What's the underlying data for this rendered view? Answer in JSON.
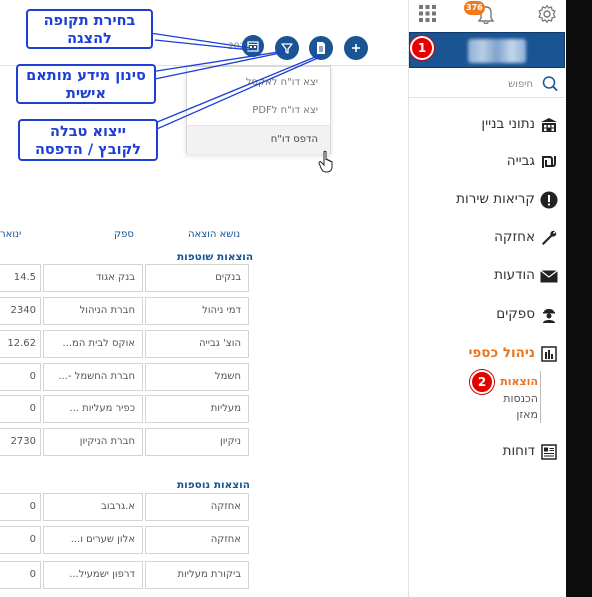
{
  "toolbar": {
    "year_value": "2021",
    "calendar_icon": "calendar-icon",
    "filter_icon": "filter-icon",
    "export_icon": "document-icon",
    "add_icon": "plus-icon"
  },
  "dropdown": {
    "items": [
      "יצא דו\"ח לאקסל",
      "יצא דו\"ח לPDF",
      "הדפס דו\"ח"
    ]
  },
  "callouts": {
    "period": [
      "בחירת תקופה",
      "להצגה"
    ],
    "filter": [
      "סינון מידע מותאם",
      "אישית"
    ],
    "export": [
      "ייצוא טבלה",
      "לקובץ / הדפסה"
    ]
  },
  "table": {
    "headers": [
      "נושא הוצאה",
      "ספק",
      "ינואר"
    ],
    "groups": [
      {
        "title": "הוצאות שוטפות",
        "rows": [
          {
            "subject": "בנקים",
            "supplier": "בנק אגוד",
            "value": "14.5"
          },
          {
            "subject": "דמי ניהול",
            "supplier": "חברת הניהול",
            "value": "2340"
          },
          {
            "subject": "הוצ' גבייה",
            "supplier": "אוקס לבית המ...",
            "value": "12.62"
          },
          {
            "subject": "חשמל",
            "supplier": "חברת החשמל -...",
            "value": "0"
          },
          {
            "subject": "מעליות",
            "supplier": "כפיר מעליות ...",
            "value": "0"
          },
          {
            "subject": "ניקיון",
            "supplier": "חברת הניקיון",
            "value": "2730"
          }
        ]
      },
      {
        "title": "הוצאות נוספות",
        "rows": [
          {
            "subject": "אחזקה",
            "supplier": "א.גרבוב",
            "value": "0"
          },
          {
            "subject": "אחזקה",
            "supplier": "אלון שערים ו...",
            "value": "0"
          },
          {
            "subject": "ביקורת מעליות",
            "supplier": "דרפון ישמעיל...",
            "value": "0"
          }
        ]
      }
    ]
  },
  "topbar": {
    "notification_count": "376"
  },
  "sidebar": {
    "search_placeholder": "חיפוש",
    "items": [
      {
        "label": "נתוני בניין",
        "icon": "building-icon"
      },
      {
        "label": "גבייה",
        "icon": "shekel-icon"
      },
      {
        "label": "קריאות שירות",
        "icon": "alert-icon"
      },
      {
        "label": "אחזקה",
        "icon": "wrench-icon"
      },
      {
        "label": "הודעות",
        "icon": "envelope-icon"
      },
      {
        "label": "ספקים",
        "icon": "worker-icon"
      },
      {
        "label": "ניהול כספי",
        "icon": "finance-icon"
      },
      {
        "label": "דוחות",
        "icon": "report-icon"
      }
    ],
    "finance_sub": [
      "הוצאות",
      "הכנסות",
      "מאזן"
    ]
  },
  "markers": {
    "one": "1",
    "two": "2"
  },
  "colors": {
    "brand": "#1a5493",
    "active": "#e8741e",
    "callout": "#1d3fd6",
    "marker": "#e60000"
  }
}
